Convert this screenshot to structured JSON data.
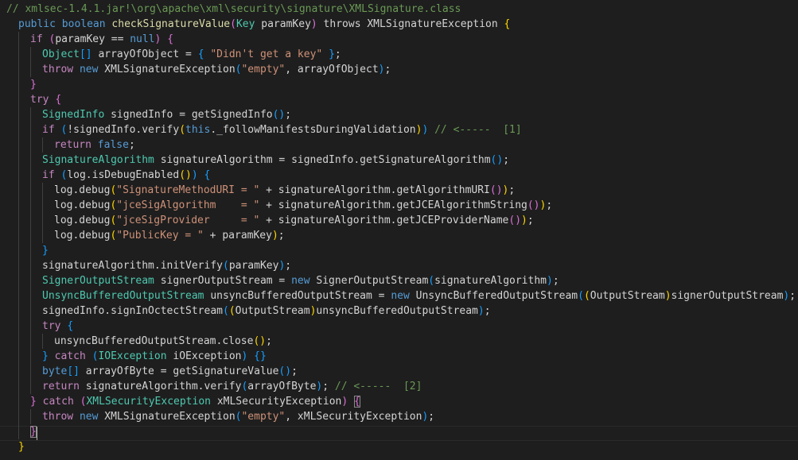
{
  "editor": {
    "path_comment": "// xmlsec-1.4.1.jar!\\org\\apache\\xml\\security\\signature\\XMLSignature.class",
    "active_line": 28,
    "lines": [
      {
        "indent": 0,
        "tokens": [
          [
            "comment",
            "// xmlsec-1.4.1.jar!\\org\\apache\\xml\\security\\signature\\XMLSignature.class"
          ]
        ]
      },
      {
        "indent": 1,
        "tokens": [
          [
            "kw",
            "public"
          ],
          [
            "plain",
            " "
          ],
          [
            "kw",
            "boolean"
          ],
          [
            "plain",
            " "
          ],
          [
            "fn",
            "checkSignatureValue"
          ],
          [
            "br2",
            "("
          ],
          [
            "type",
            "Key"
          ],
          [
            "plain",
            " paramKey"
          ],
          [
            "br2",
            ")"
          ],
          [
            "plain",
            " throws XMLSignatureException "
          ],
          [
            "br1",
            "{"
          ]
        ]
      },
      {
        "indent": 2,
        "tokens": [
          [
            "ctrl",
            "if"
          ],
          [
            "plain",
            " "
          ],
          [
            "br2",
            "("
          ],
          [
            "plain",
            "paramKey == "
          ],
          [
            "kw",
            "null"
          ],
          [
            "br2",
            ")"
          ],
          [
            "plain",
            " "
          ],
          [
            "br2",
            "{"
          ]
        ]
      },
      {
        "indent": 3,
        "tokens": [
          [
            "type",
            "Object"
          ],
          [
            "br3",
            "[]"
          ],
          [
            "plain",
            " arrayOfObject = "
          ],
          [
            "br3",
            "{"
          ],
          [
            "plain",
            " "
          ],
          [
            "str",
            "\"Didn't get a key\""
          ],
          [
            "plain",
            " "
          ],
          [
            "br3",
            "}"
          ],
          [
            "plain",
            ";"
          ]
        ]
      },
      {
        "indent": 3,
        "tokens": [
          [
            "ctrl",
            "throw"
          ],
          [
            "plain",
            " "
          ],
          [
            "kw",
            "new"
          ],
          [
            "plain",
            " XMLSignatureException"
          ],
          [
            "br3",
            "("
          ],
          [
            "str",
            "\"empty\""
          ],
          [
            "plain",
            ", arrayOfObject"
          ],
          [
            "br3",
            ")"
          ],
          [
            "plain",
            ";"
          ]
        ]
      },
      {
        "indent": 2,
        "tokens": [
          [
            "br2",
            "}"
          ]
        ]
      },
      {
        "indent": 2,
        "tokens": [
          [
            "ctrl",
            "try"
          ],
          [
            "plain",
            " "
          ],
          [
            "br2",
            "{"
          ]
        ]
      },
      {
        "indent": 3,
        "tokens": [
          [
            "type",
            "SignedInfo"
          ],
          [
            "plain",
            " signedInfo = getSignedInfo"
          ],
          [
            "br3",
            "()"
          ],
          [
            "plain",
            ";"
          ]
        ]
      },
      {
        "indent": 3,
        "tokens": [
          [
            "ctrl",
            "if"
          ],
          [
            "plain",
            " "
          ],
          [
            "br3",
            "("
          ],
          [
            "plain",
            "!signedInfo.verify"
          ],
          [
            "br1",
            "("
          ],
          [
            "kw",
            "this"
          ],
          [
            "plain",
            "._followManifestsDuringValidation"
          ],
          [
            "br1",
            ")"
          ],
          [
            "br3",
            ")"
          ],
          [
            "plain",
            " "
          ],
          [
            "comment",
            "// <-----  [1]"
          ]
        ]
      },
      {
        "indent": 4,
        "tokens": [
          [
            "ctrl",
            "return"
          ],
          [
            "plain",
            " "
          ],
          [
            "kw",
            "false"
          ],
          [
            "plain",
            ";"
          ]
        ]
      },
      {
        "indent": 3,
        "tokens": [
          [
            "type",
            "SignatureAlgorithm"
          ],
          [
            "plain",
            " signatureAlgorithm = signedInfo.getSignatureAlgorithm"
          ],
          [
            "br3",
            "()"
          ],
          [
            "plain",
            ";"
          ]
        ]
      },
      {
        "indent": 3,
        "tokens": [
          [
            "ctrl",
            "if"
          ],
          [
            "plain",
            " "
          ],
          [
            "br3",
            "("
          ],
          [
            "plain",
            "log.isDebugEnabled"
          ],
          [
            "br1",
            "()"
          ],
          [
            "br3",
            ")"
          ],
          [
            "plain",
            " "
          ],
          [
            "br3",
            "{"
          ]
        ]
      },
      {
        "indent": 4,
        "tokens": [
          [
            "plain",
            "log.debug"
          ],
          [
            "br1",
            "("
          ],
          [
            "str",
            "\"SignatureMethodURI = \""
          ],
          [
            "plain",
            " + signatureAlgorithm.getAlgorithmURI"
          ],
          [
            "br2",
            "()"
          ],
          [
            "br1",
            ")"
          ],
          [
            "plain",
            ";"
          ]
        ]
      },
      {
        "indent": 4,
        "tokens": [
          [
            "plain",
            "log.debug"
          ],
          [
            "br1",
            "("
          ],
          [
            "str",
            "\"jceSigAlgorithm    = \""
          ],
          [
            "plain",
            " + signatureAlgorithm.getJCEAlgorithmString"
          ],
          [
            "br2",
            "()"
          ],
          [
            "br1",
            ")"
          ],
          [
            "plain",
            ";"
          ]
        ]
      },
      {
        "indent": 4,
        "tokens": [
          [
            "plain",
            "log.debug"
          ],
          [
            "br1",
            "("
          ],
          [
            "str",
            "\"jceSigProvider     = \""
          ],
          [
            "plain",
            " + signatureAlgorithm.getJCEProviderName"
          ],
          [
            "br2",
            "()"
          ],
          [
            "br1",
            ")"
          ],
          [
            "plain",
            ";"
          ]
        ]
      },
      {
        "indent": 4,
        "tokens": [
          [
            "plain",
            "log.debug"
          ],
          [
            "br1",
            "("
          ],
          [
            "str",
            "\"PublicKey = \""
          ],
          [
            "plain",
            " + paramKey"
          ],
          [
            "br1",
            ")"
          ],
          [
            "plain",
            ";"
          ]
        ]
      },
      {
        "indent": 3,
        "tokens": [
          [
            "br3",
            "}"
          ]
        ]
      },
      {
        "indent": 3,
        "tokens": [
          [
            "plain",
            "signatureAlgorithm.initVerify"
          ],
          [
            "br3",
            "("
          ],
          [
            "plain",
            "paramKey"
          ],
          [
            "br3",
            ")"
          ],
          [
            "plain",
            ";"
          ]
        ]
      },
      {
        "indent": 3,
        "tokens": [
          [
            "type",
            "SignerOutputStream"
          ],
          [
            "plain",
            " signerOutputStream = "
          ],
          [
            "kw",
            "new"
          ],
          [
            "plain",
            " SignerOutputStream"
          ],
          [
            "br3",
            "("
          ],
          [
            "plain",
            "signatureAlgorithm"
          ],
          [
            "br3",
            ")"
          ],
          [
            "plain",
            ";"
          ]
        ]
      },
      {
        "indent": 3,
        "tokens": [
          [
            "type",
            "UnsyncBufferedOutputStream"
          ],
          [
            "plain",
            " unsyncBufferedOutputStream = "
          ],
          [
            "kw",
            "new"
          ],
          [
            "plain",
            " UnsyncBufferedOutputStream"
          ],
          [
            "br3",
            "("
          ],
          [
            "br1",
            "("
          ],
          [
            "plain",
            "OutputStream"
          ],
          [
            "br1",
            ")"
          ],
          [
            "plain",
            "signerOutputStream"
          ],
          [
            "br3",
            ")"
          ],
          [
            "plain",
            ";"
          ]
        ]
      },
      {
        "indent": 3,
        "tokens": [
          [
            "plain",
            "signedInfo.signInOctectStream"
          ],
          [
            "br3",
            "("
          ],
          [
            "br1",
            "("
          ],
          [
            "plain",
            "OutputStream"
          ],
          [
            "br1",
            ")"
          ],
          [
            "plain",
            "unsyncBufferedOutputStream"
          ],
          [
            "br3",
            ")"
          ],
          [
            "plain",
            ";"
          ]
        ]
      },
      {
        "indent": 3,
        "tokens": [
          [
            "ctrl",
            "try"
          ],
          [
            "plain",
            " "
          ],
          [
            "br3",
            "{"
          ]
        ]
      },
      {
        "indent": 4,
        "tokens": [
          [
            "plain",
            "unsyncBufferedOutputStream.close"
          ],
          [
            "br1",
            "()"
          ],
          [
            "plain",
            ";"
          ]
        ]
      },
      {
        "indent": 3,
        "tokens": [
          [
            "br3",
            "}"
          ],
          [
            "plain",
            " "
          ],
          [
            "ctrl",
            "catch"
          ],
          [
            "plain",
            " "
          ],
          [
            "br3",
            "("
          ],
          [
            "type",
            "IOException"
          ],
          [
            "plain",
            " iOException"
          ],
          [
            "br3",
            ")"
          ],
          [
            "plain",
            " "
          ],
          [
            "br3",
            "{}"
          ]
        ]
      },
      {
        "indent": 3,
        "tokens": [
          [
            "kw",
            "byte"
          ],
          [
            "br3",
            "[]"
          ],
          [
            "plain",
            " arrayOfByte = getSignatureValue"
          ],
          [
            "br3",
            "()"
          ],
          [
            "plain",
            ";"
          ]
        ]
      },
      {
        "indent": 3,
        "tokens": [
          [
            "ctrl",
            "return"
          ],
          [
            "plain",
            " signatureAlgorithm.verify"
          ],
          [
            "br3",
            "("
          ],
          [
            "plain",
            "arrayOfByte"
          ],
          [
            "br3",
            ")"
          ],
          [
            "plain",
            "; "
          ],
          [
            "comment",
            "// <-----  [2]"
          ]
        ]
      },
      {
        "indent": 2,
        "tokens": [
          [
            "br2",
            "}"
          ],
          [
            "plain",
            " "
          ],
          [
            "ctrl",
            "catch"
          ],
          [
            "plain",
            " "
          ],
          [
            "br2",
            "("
          ],
          [
            "type",
            "XMLSecurityException"
          ],
          [
            "plain",
            " xMLSecurityException"
          ],
          [
            "br2",
            ")"
          ],
          [
            "plain",
            " "
          ],
          [
            "br2m",
            "{"
          ]
        ]
      },
      {
        "indent": 3,
        "tokens": [
          [
            "ctrl",
            "throw"
          ],
          [
            "plain",
            " "
          ],
          [
            "kw",
            "new"
          ],
          [
            "plain",
            " XMLSignatureException"
          ],
          [
            "br3",
            "("
          ],
          [
            "str",
            "\"empty\""
          ],
          [
            "plain",
            ", xMLSecurityException"
          ],
          [
            "br3",
            ")"
          ],
          [
            "plain",
            ";"
          ]
        ]
      },
      {
        "indent": 2,
        "tokens": [
          [
            "br2m",
            "}"
          ]
        ]
      },
      {
        "indent": 1,
        "tokens": [
          [
            "br1",
            "}"
          ]
        ]
      }
    ]
  },
  "colors": {
    "background": "#1e1e1e",
    "comment": "#6a9955",
    "keyword": "#569cd6",
    "control": "#c586c0",
    "type": "#4ec9b0",
    "function": "#dcdcaa",
    "string": "#ce9178",
    "bracket_gold": "#ffd700",
    "bracket_orchid": "#da70d6",
    "bracket_blue": "#179fff"
  }
}
